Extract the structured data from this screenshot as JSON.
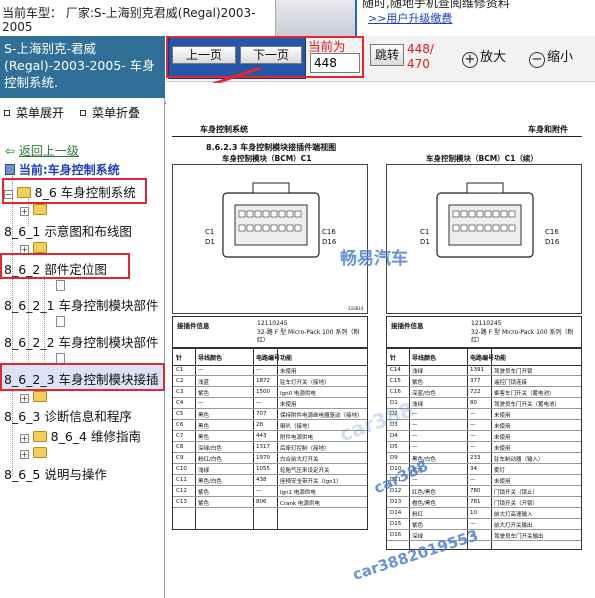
{
  "header": {
    "car_model": "当前车型： 厂家:S-上海别克君威(Regal)2003-2005",
    "banner_line1": "随时,随地手机查阅维修资料",
    "banner_line2": ">>用户升级缴费"
  },
  "sidebar": {
    "title": "S-上海别克-君威(Regal)-2003-2005- 车身控制系统.",
    "expand_label": "菜单展开",
    "collapse_label": "菜单折叠",
    "back_label": "返回上一级",
    "current_label": "当前:车身控制系统",
    "tree": [
      {
        "label": "8_6 车身控制系统"
      },
      {
        "label": "8_6_1 示意图和布线图"
      },
      {
        "label": "8_6_2 部件定位图"
      },
      {
        "label": "8_6_2_1 车身控制模块部件"
      },
      {
        "label": "8_6_2_2 车身控制模块部件"
      },
      {
        "label": "8_6_2_3 车身控制模块接插"
      },
      {
        "label": "8_6_3 诊断信息和程序"
      },
      {
        "label": "8_6_4 维修指南"
      },
      {
        "label": "8_6_5 说明与操作"
      }
    ]
  },
  "toolbar": {
    "prev_label": "上一页",
    "next_label": "下一页",
    "current_label": "当前为",
    "page_value": "448",
    "jump_label": "跳转",
    "page_count": "448/\n470",
    "zoom_in_label": "放大",
    "zoom_out_label": "缩小"
  },
  "document": {
    "section_left": "车身控制系统",
    "section_right": "车身和附件",
    "heading": "8.6.2.3 车身控制模块接插件端视图",
    "sub_left": "车身控制模块（BCM）C1",
    "sub_right": "车身控制模块（BCM）C1（续）",
    "pin_c16": "C16",
    "pin_d16": "D16",
    "pin_c1": "C1",
    "pin_d1": "D1",
    "figure_no": "333814",
    "info_label": "接插件信息",
    "info_items": [
      "12110245",
      "32-路 F 型 Micro-Pack 100 系列（粉红）"
    ],
    "col_pin": "针",
    "col_color": "导线颜色",
    "col_circuit": "电路编号",
    "col_function": "功能",
    "rows_left": [
      [
        "C1",
        "—",
        "—",
        "未使用"
      ],
      [
        "C2",
        "浅蓝",
        "1872",
        "驻车灯开关（接地）"
      ],
      [
        "C3",
        "紫色",
        "1500",
        "Ign0 电源供电"
      ],
      [
        "C4",
        "—",
        "—",
        "未使用"
      ],
      [
        "C5",
        "黑色",
        "707",
        "保持附件电源继电器驱动（接地）"
      ],
      [
        "C6",
        "黑色",
        "28",
        "喇叭（接地）"
      ],
      [
        "C7",
        "黑色",
        "443",
        "附件电源供电"
      ],
      [
        "C8",
        "深绿/白色",
        "1317",
        "后牵灯控制（接地）"
      ],
      [
        "C9",
        "粉红/白色",
        "1970",
        "白合前大灯开关"
      ],
      [
        "C10",
        "浅绿",
        "1055",
        "轮胎气压来设定开关"
      ],
      [
        "C11",
        "黑色/白色",
        "438",
        "座椅安全带开关（Ign1）"
      ],
      [
        "C12",
        "紫色",
        "—",
        "Ign1 电源供电"
      ],
      [
        "C13",
        "紫色",
        "806",
        "Crank 电源供电"
      ]
    ],
    "rows_right": [
      [
        "C14",
        "浅绿",
        "1391",
        "驾驶员车门开锁"
      ],
      [
        "C15",
        "紫色",
        "377",
        "遥控门锁连接"
      ],
      [
        "C16",
        "深蓝/白色",
        "722",
        "乘客车门开关（蓄电池）"
      ],
      [
        "D1",
        "浅绿",
        "80",
        "驾驶员车门开关（蓄电池）"
      ],
      [
        "D2",
        "—",
        "—",
        "未使用"
      ],
      [
        "D3",
        "—",
        "—",
        "未使用"
      ],
      [
        "D4",
        "—",
        "—",
        "未使用"
      ],
      [
        "D5",
        "—",
        "—",
        "未使用"
      ],
      [
        "D9",
        "黑色/白色",
        "233",
        "驻车制动器（输入）"
      ],
      [
        "D10",
        "紫色",
        "34",
        "雾灯"
      ],
      [
        "D11",
        "—",
        "—",
        "未使用"
      ],
      [
        "D12",
        "红色/黑色",
        "780",
        "门锁开关（锁止）"
      ],
      [
        "D13",
        "橙色/黑色",
        "781",
        "门锁开关（开锁）"
      ],
      [
        "D14",
        "粉红",
        "10",
        "前大灯高速输入"
      ],
      [
        "D15",
        "紫色",
        "—",
        "前大灯开关输出"
      ],
      [
        "D16",
        "深绿",
        "—",
        "驾驶员车门开关输出"
      ]
    ],
    "watermarks": [
      "畅易汽车",
      "car388",
      "car388",
      "car3882019553"
    ]
  },
  "colors": {
    "panel_header": "#2f6f98",
    "nav_group": "#2556a8",
    "highlight_red": "#e3262f",
    "watermark_blue": "#4d7fd6"
  }
}
